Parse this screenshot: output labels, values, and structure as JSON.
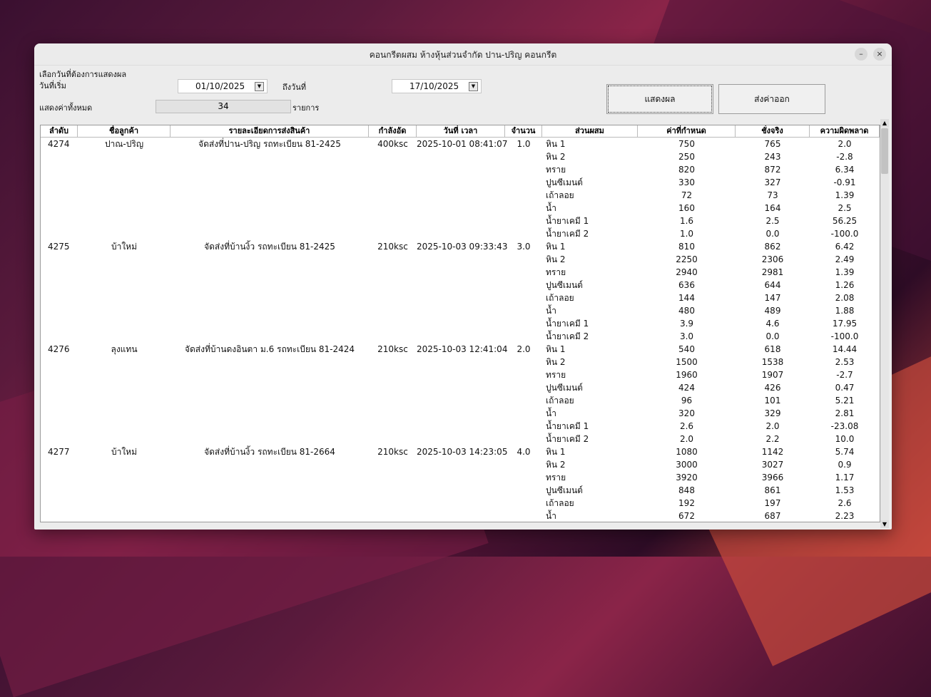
{
  "window": {
    "title": "คอนกรีตผสม ห้างหุ้นส่วนจำกัด ปาน-ปริญ คอนกรีต",
    "min_icon": "–",
    "close_icon": "×"
  },
  "filter": {
    "select_dates_label": "เลือกวันที่ต้องการแสดงผล",
    "start_label": "วันที่เริ่ม",
    "start_date": "01/10/2025",
    "end_label": "ถึงวันที่",
    "end_date": "17/10/2025",
    "total_label": "แสดงค่าทั้งหมด",
    "total_count": "34",
    "total_unit": "รายการ"
  },
  "buttons": {
    "show": "แสดงผล",
    "export": "ส่งค่าออก"
  },
  "table": {
    "headers": [
      "ลำดับ",
      "ชื่อลูกค้า",
      "รายละเอียดการส่งสินค้า",
      "กำลังอัด",
      "วันที่ เวลา",
      "จำนวน",
      "ส่วนผสม",
      "ค่าที่กำหนด",
      "ชั่งจริง",
      "ความผิดพลาด"
    ],
    "orders": [
      {
        "id": "4274",
        "customer": "ปาณ-ปริญ",
        "detail": "จัดส่งที่ปาน-ปริญ รถทะเบียน 81-2425",
        "strength": "400ksc",
        "datetime": "2025-10-01 08:41:07",
        "qty": "1.0",
        "items": [
          [
            "หิน 1",
            "750",
            "765",
            "2.0"
          ],
          [
            "หิน 2",
            "250",
            "243",
            "-2.8"
          ],
          [
            "ทราย",
            "820",
            "872",
            "6.34"
          ],
          [
            "ปูนซีเมนต์",
            "330",
            "327",
            "-0.91"
          ],
          [
            "เถ้าลอย",
            "72",
            "73",
            "1.39"
          ],
          [
            "น้ำ",
            "160",
            "164",
            "2.5"
          ],
          [
            "น้ำยาเคมี 1",
            "1.6",
            "2.5",
            "56.25"
          ],
          [
            "น้ำยาเคมี 2",
            "1.0",
            "0.0",
            "-100.0"
          ]
        ]
      },
      {
        "id": "4275",
        "customer": "บ้าใหม่",
        "detail": "จัดส่งที่บ้านงิ้ว รถทะเบียน 81-2425",
        "strength": "210ksc",
        "datetime": "2025-10-03 09:33:43",
        "qty": "3.0",
        "items": [
          [
            "หิน 1",
            "810",
            "862",
            "6.42"
          ],
          [
            "หิน 2",
            "2250",
            "2306",
            "2.49"
          ],
          [
            "ทราย",
            "2940",
            "2981",
            "1.39"
          ],
          [
            "ปูนซีเมนต์",
            "636",
            "644",
            "1.26"
          ],
          [
            "เถ้าลอย",
            "144",
            "147",
            "2.08"
          ],
          [
            "น้ำ",
            "480",
            "489",
            "1.88"
          ],
          [
            "น้ำยาเคมี 1",
            "3.9",
            "4.6",
            "17.95"
          ],
          [
            "น้ำยาเคมี 2",
            "3.0",
            "0.0",
            "-100.0"
          ]
        ]
      },
      {
        "id": "4276",
        "customer": "ลุงแทน",
        "detail": "จัดส่งที่บ้านดงอินตา ม.6 รถทะเบียน 81-2424",
        "strength": "210ksc",
        "datetime": "2025-10-03 12:41:04",
        "qty": "2.0",
        "items": [
          [
            "หิน 1",
            "540",
            "618",
            "14.44"
          ],
          [
            "หิน 2",
            "1500",
            "1538",
            "2.53"
          ],
          [
            "ทราย",
            "1960",
            "1907",
            "-2.7"
          ],
          [
            "ปูนซีเมนต์",
            "424",
            "426",
            "0.47"
          ],
          [
            "เถ้าลอย",
            "96",
            "101",
            "5.21"
          ],
          [
            "น้ำ",
            "320",
            "329",
            "2.81"
          ],
          [
            "น้ำยาเคมี 1",
            "2.6",
            "2.0",
            "-23.08"
          ],
          [
            "น้ำยาเคมี 2",
            "2.0",
            "2.2",
            "10.0"
          ]
        ]
      },
      {
        "id": "4277",
        "customer": "บ้าใหม่",
        "detail": "จัดส่งที่บ้านงิ้ว รถทะเบียน 81-2664",
        "strength": "210ksc",
        "datetime": "2025-10-03 14:23:05",
        "qty": "4.0",
        "items": [
          [
            "หิน 1",
            "1080",
            "1142",
            "5.74"
          ],
          [
            "หิน 2",
            "3000",
            "3027",
            "0.9"
          ],
          [
            "ทราย",
            "3920",
            "3966",
            "1.17"
          ],
          [
            "ปูนซีเมนต์",
            "848",
            "861",
            "1.53"
          ],
          [
            "เถ้าลอย",
            "192",
            "197",
            "2.6"
          ],
          [
            "น้ำ",
            "672",
            "687",
            "2.23"
          ]
        ]
      }
    ]
  }
}
